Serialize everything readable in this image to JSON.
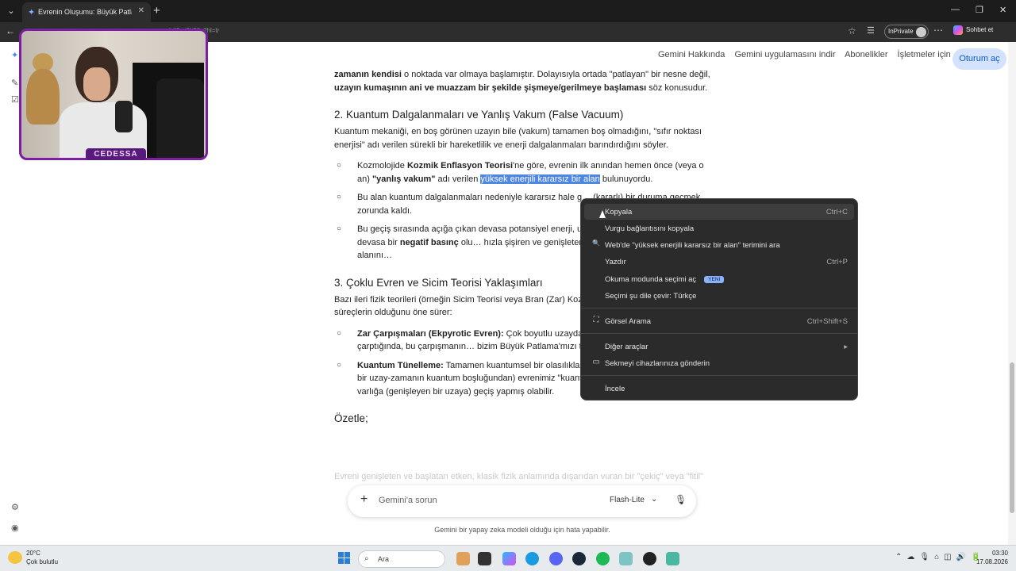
{
  "browser": {
    "tab_title": "Evrenin Oluşumu: Büyük Patlama",
    "tab_close": "✕",
    "new_tab": "+",
    "url": "…b43…8b58c?hl=tr",
    "inprivate_label": "InPrivate",
    "copilot_label": "Sohbet et",
    "window_controls": [
      "—",
      "❐",
      "✕"
    ]
  },
  "nav": {
    "items": [
      "Gemini Hakkında",
      "Gemini uygulamasını indir",
      "Abonelikler",
      "İşletmeler için"
    ],
    "login_label": "Oturum aç"
  },
  "article": {
    "intro_bold_1": "zamanın kendisi",
    "intro_text_1": " o noktada var olmaya başlamıştır. Dolayısıyla ortada \"patlayan\" bir nesne değil, ",
    "intro_bold_2": "uzayın kumaşının ani ve muazzam bir şekilde şişmeye/gerilmeye başlaması",
    "intro_text_2": " söz konusudur.",
    "h2_1": "2. Kuantum Dalgalanmaları ve Yanlış Vakum (False Vacuum)",
    "p2": "Kuantum mekaniği, en boş görünen uzayın bile (vakum) tamamen boş olmadığını, \"sıfır noktası enerjisi\" adı verilen sürekli bir hareketlilik ve enerji dalgalanmaları barındırdığını söyler.",
    "b1_pre": "Kozmolojide ",
    "b1_bold1": "Kozmik Enflasyon Teorisi",
    "b1_mid": "'ne göre, evrenin ilk anından hemen önce (veya o an) ",
    "b1_bold2": "\"yanlış vakum\"",
    "b1_post": " adı verilen ",
    "b1_hl": "yüksek enerjili kararsız bir alan",
    "b1_end": " bulunuyordu.",
    "b2": "Bu alan kuantum dalgalanmaları nedeniyle kararsız hale g… (kararlı) bir duruma geçmek zorunda kaldı.",
    "b3_pre": "Bu geçiş sırasında açığa çıkan devasa potansiyel enerji, u… aksine itici bir güç yaratan) devasa bir ",
    "b3_bold": "negatif basınç",
    "b3_post": " olu… hızla şişiren ve genişleten etken bu kuantum enerji alanını…",
    "h2_2": "3. Çoklu Evren ve Sicim Teorisi Yaklaşımları",
    "p3": "Bazı ileri fizik teorileri (örneğin Sicim Teorisi veya Bran (Zar) Koz… başlamasından önce de başka süreçlerin olduğunu öne sürer:",
    "b4_bold": "Zar Çarpışmaları (Ekpyrotic Evren):",
    "b4_text": " Çok boyutlu uzayda… (evren benzeri yapı) birbirine çarptığında, bu çarpışmanın… bizim Büyük Patlama'mızı tetiklemiş olabilir.",
    "b5_bold": "Kuantum Tünelleme:",
    "b5_text": " Tamamen kuantumsel bir olasılıkla, hiçbir şeyin olmadığı (veya başka bir uzay-zamanın kuantum boşluğundan) evrenimiz \"kuantum tünelleme\" yoluyla yokluktan varlığa (genişleyen bir uzaya) geçiş yapmış olabilir.",
    "h2_3": "Özetle;",
    "fade_text": "Evreni genişleten ve başlatan etken, klasik fizik anlamında dışarıdan vuran bir \"çekiç\" veya \"fitil\""
  },
  "webcam": {
    "name": "CEDESSA"
  },
  "context_menu": {
    "items": [
      {
        "label": "Kopyala",
        "shortcut": "Ctrl+C",
        "icon": ""
      },
      {
        "label": "Vurgu bağlantısını kopyala",
        "shortcut": "",
        "icon": ""
      },
      {
        "label": "Web'de \"yüksek enerjili kararsız bir alan\" terimini ara",
        "shortcut": "",
        "icon": "🔍"
      },
      {
        "label": "Yazdır",
        "shortcut": "Ctrl+P",
        "icon": ""
      },
      {
        "label": "Okuma modunda seçimi aç",
        "shortcut": "",
        "icon": "",
        "badge": "YENİ"
      },
      {
        "label": "Seçimi şu dile çevir: Türkçe",
        "shortcut": "",
        "icon": ""
      },
      {
        "label": "Görsel Arama",
        "shortcut": "Ctrl+Shift+S",
        "icon": "⛶"
      },
      {
        "label": "Diğer araçlar",
        "shortcut": "▸",
        "icon": ""
      },
      {
        "label": "Sekmeyi cihazlarınıza gönderin",
        "shortcut": "",
        "icon": "▭"
      },
      {
        "label": "İncele",
        "shortcut": "",
        "icon": ""
      }
    ]
  },
  "chat": {
    "placeholder": "Gemini'a sorun",
    "model": "Flash-Lite",
    "disclaimer": "Gemini bir yapay zeka modeli olduğu için hata yapabilir."
  },
  "taskbar": {
    "temperature": "20°C",
    "weather": "Çok bulutlu",
    "search_label": "Ara",
    "time": "03:30",
    "date": "17.08.2026"
  },
  "colors": {
    "selection": "#4d86e3",
    "login_bg": "#d3e3fd",
    "webcam_frame": "#7b1fa2"
  }
}
